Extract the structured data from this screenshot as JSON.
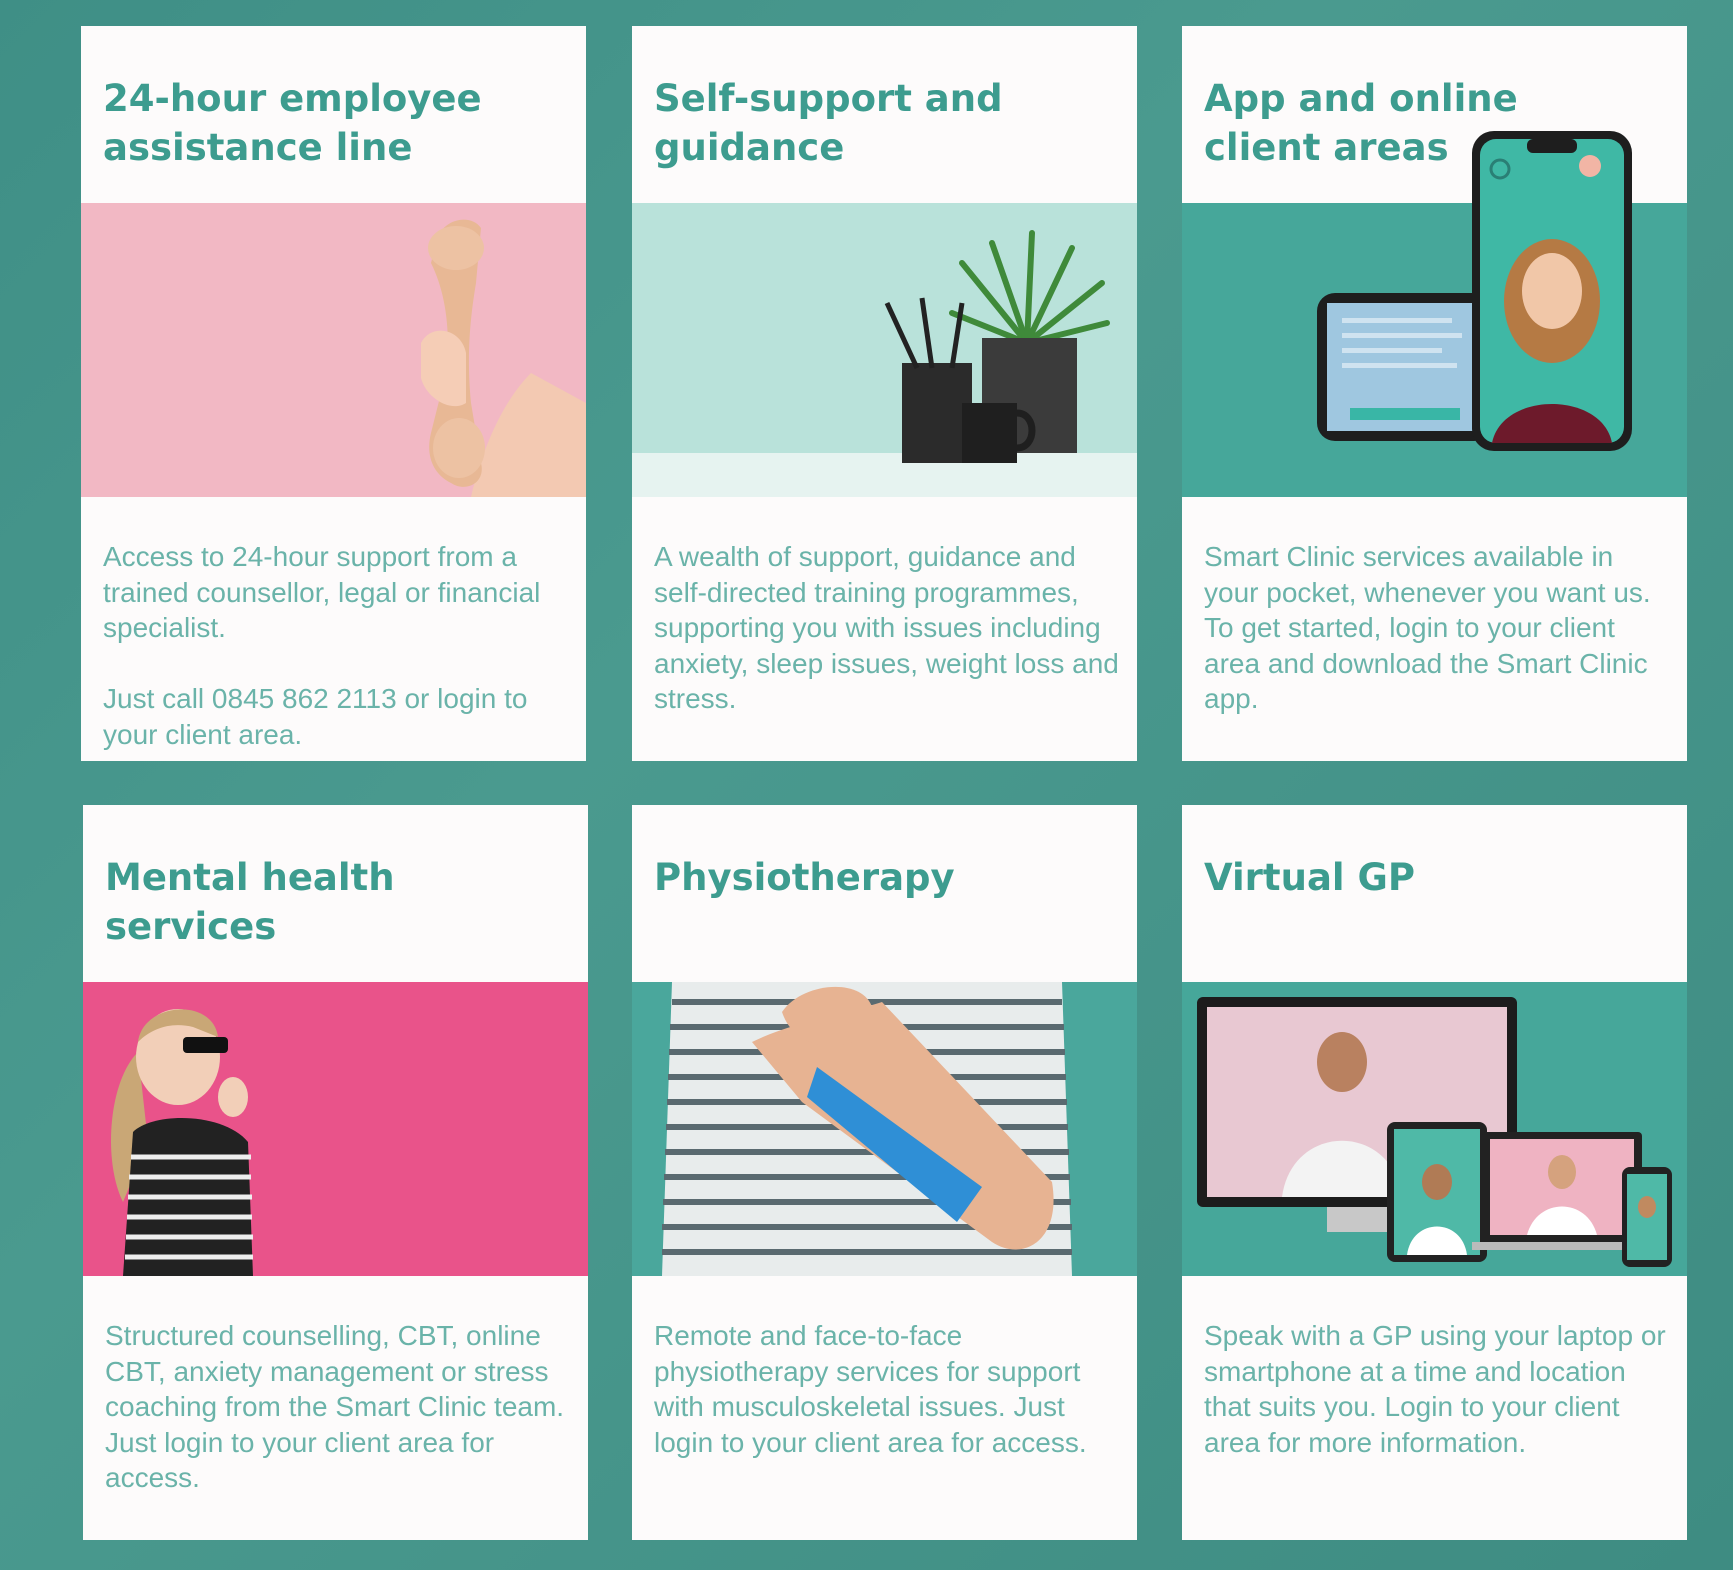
{
  "cards": [
    {
      "title": "24-hour employee\nassistance line",
      "body": "Access to 24-hour support from a trained counsellor, legal or financial specialist.\n\nJust call 0845 862 2113 or login to your client area."
    },
    {
      "title": "Self-support and\nguidance",
      "body": "A wealth of support, guidance and self-directed training programmes, supporting you with issues including anxiety, sleep issues, weight loss and stress."
    },
    {
      "title": "App and online\nclient areas",
      "body": "Smart Clinic services available in your pocket, whenever you want us.\nTo get started, login to your client area and download the Smart Clinic app."
    },
    {
      "title": "Mental health services",
      "body": "Structured counselling, CBT, online CBT, anxiety management or stress coaching from the Smart Clinic team. Just login to your client area for access."
    },
    {
      "title": "Physiotherapy",
      "body": "Remote and face-to-face physiotherapy services for support with musculoskeletal issues. Just login to your client area for access."
    },
    {
      "title": "Virtual GP",
      "body": "Speak with a GP using your laptop or smartphone at a time and location that suits you. Login to your client area for more information."
    }
  ],
  "colors": {
    "background": "#468f86",
    "card": "#fdfbfb",
    "title": "#3d9c8f",
    "body_text": "#6ab3a9"
  }
}
